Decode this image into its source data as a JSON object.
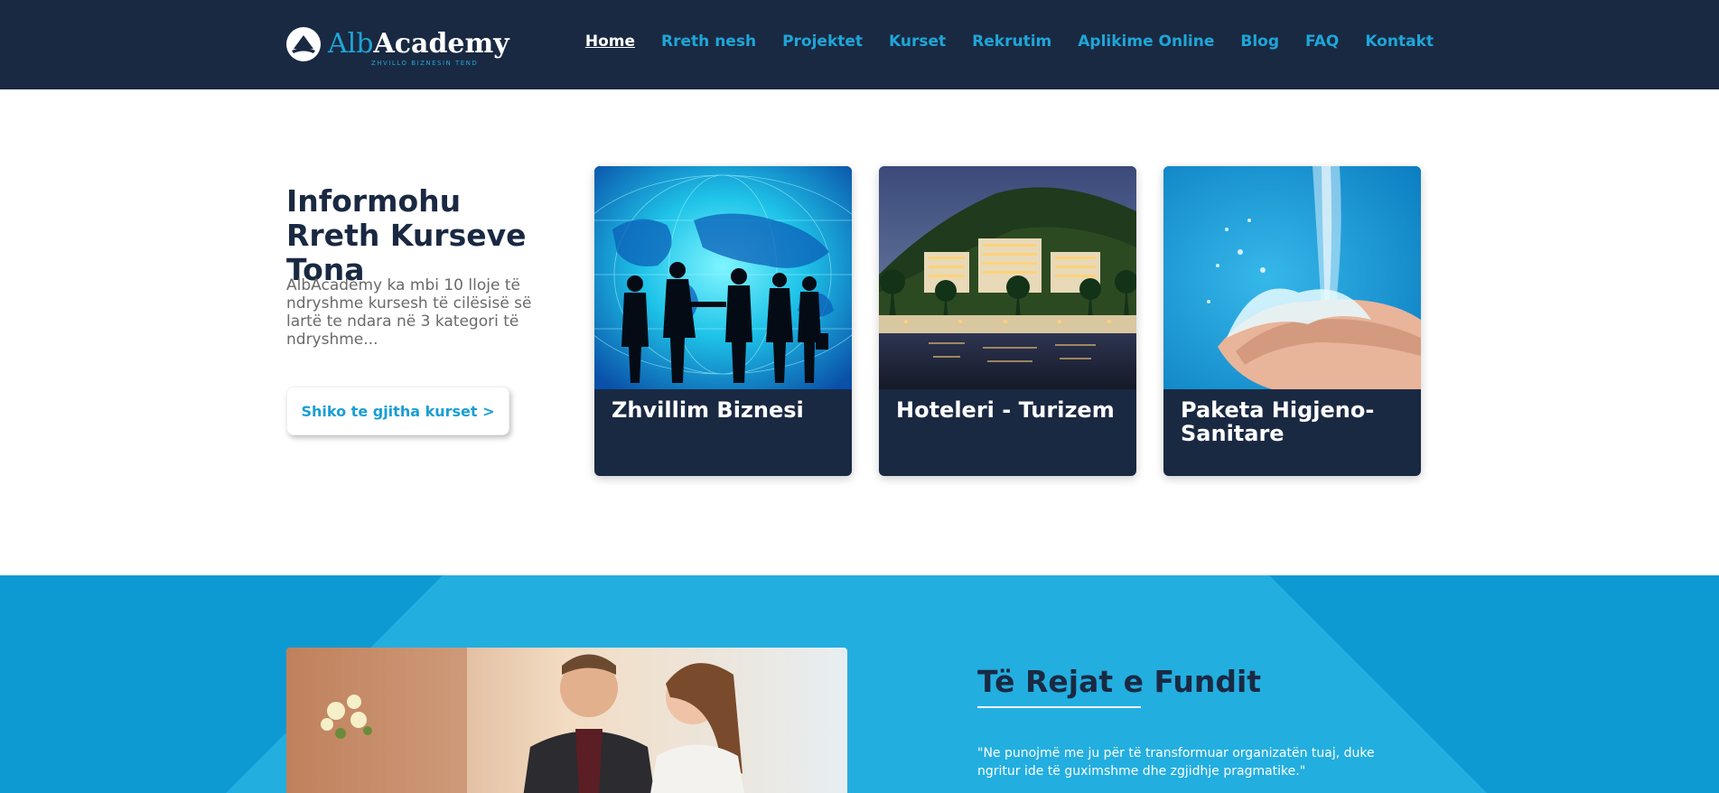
{
  "header": {
    "logo": {
      "alb": "Alb",
      "academy": "Academy",
      "tagline": "ZHVILLO BIZNESIN TEND"
    },
    "nav": [
      {
        "label": "Home",
        "active": true
      },
      {
        "label": "Rreth nesh"
      },
      {
        "label": "Projektet"
      },
      {
        "label": "Kurset"
      },
      {
        "label": "Rekrutim"
      },
      {
        "label": "Aplikime Online"
      },
      {
        "label": "Blog"
      },
      {
        "label": "FAQ"
      },
      {
        "label": "Kontakt"
      }
    ]
  },
  "courses": {
    "title": "Informohu Rreth Kurseve Tona",
    "description": "AlbAcademy ka mbi 10 lloje të ndryshme kursesh të cilësisë së lartë te ndara në 3 kategori të ndryshme...",
    "button_label": "Shiko te gjitha kurset >",
    "cards": [
      {
        "title": "Zhvillim Biznesi",
        "image": "business-people-world-map"
      },
      {
        "title": "Hoteleri - Turizem",
        "image": "hotel-resort-night"
      },
      {
        "title": "Paketa Higjeno-Sanitare",
        "image": "hands-water-splash"
      }
    ]
  },
  "news": {
    "title": "Të Rejat e Fundit",
    "quote": "\"Ne punojmë me ju për të transformuar organizatën tuaj, duke ngritur ide të guximshme dhe zgjidhje pragmatike.\"",
    "image": "waiter-serving-woman-restaurant"
  },
  "colors": {
    "header_bg": "#1a2942",
    "accent": "#1ea6d8",
    "news_bg": "#0d9ad3"
  }
}
